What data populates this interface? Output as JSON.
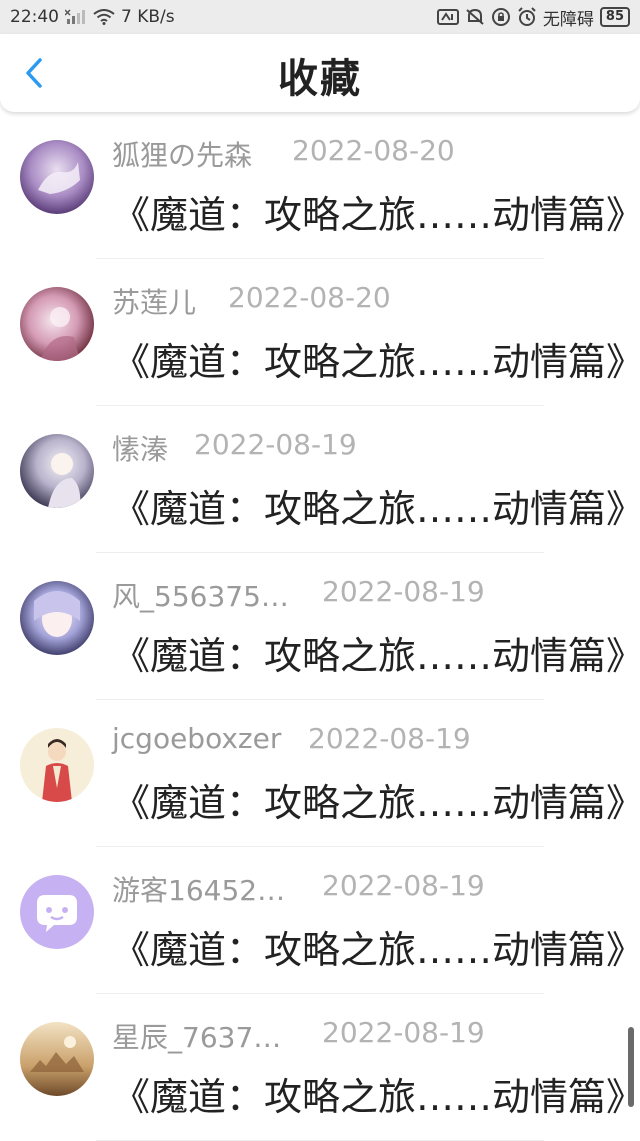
{
  "status_bar": {
    "time": "22:40",
    "speed": "7 KB/s",
    "accessibility": "无障碍",
    "battery": "85"
  },
  "header": {
    "title": "收藏"
  },
  "items": [
    {
      "name": "狐狸の先森",
      "date": "2022-08-20",
      "book": "《魔道：攻略之旅……动情篇》"
    },
    {
      "name": "苏莲儿",
      "date": "2022-08-20",
      "book": "《魔道：攻略之旅……动情篇》"
    },
    {
      "name": "愫溱",
      "date": "2022-08-19",
      "book": "《魔道：攻略之旅……动情篇》"
    },
    {
      "name": "风_556375…",
      "date": "2022-08-19",
      "book": "《魔道：攻略之旅……动情篇》"
    },
    {
      "name": "jcgoeboxzer",
      "date": "2022-08-19",
      "book": "《魔道：攻略之旅……动情篇》"
    },
    {
      "name": "游客16452…",
      "date": "2022-08-19",
      "book": "《魔道：攻略之旅……动情篇》"
    },
    {
      "name": "星辰_7637…",
      "date": "2022-08-19",
      "book": "《魔道：攻略之旅……动情篇》"
    }
  ]
}
